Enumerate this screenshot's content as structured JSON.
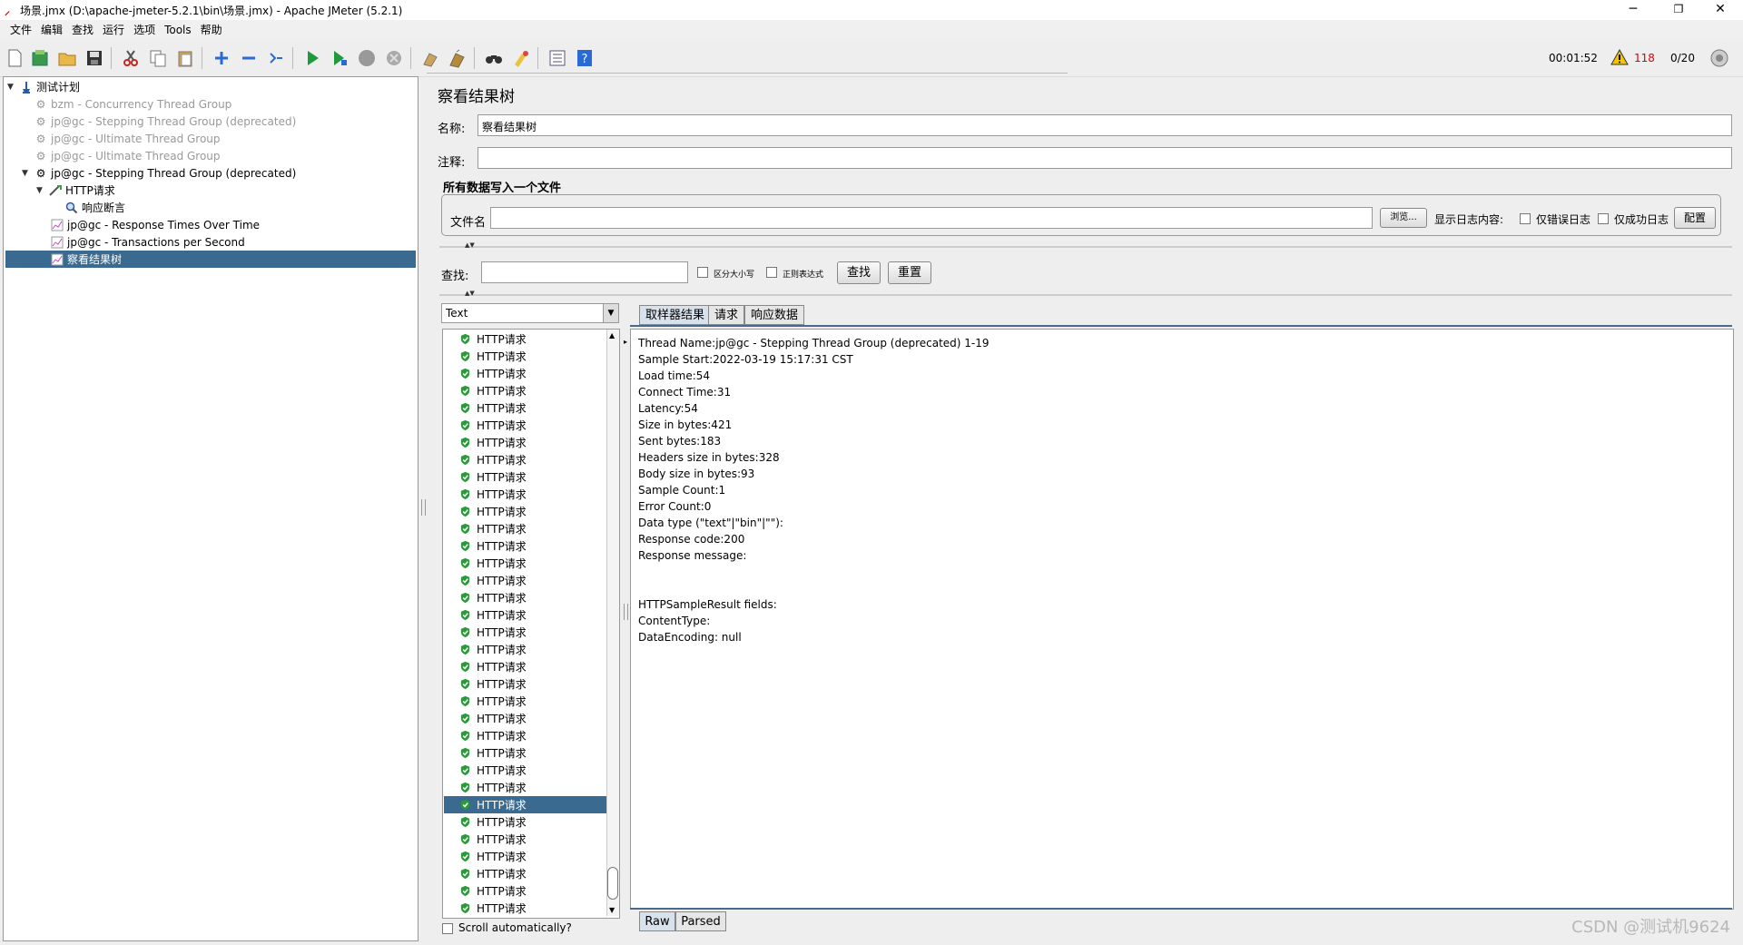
{
  "window": {
    "title": "场景.jmx (D:\\apache-jmeter-5.2.1\\bin\\场景.jmx) - Apache JMeter (5.2.1)",
    "minimize": "─",
    "restore": "❐",
    "close": "✕"
  },
  "menu": [
    "文件",
    "编辑",
    "查找",
    "运行",
    "选项",
    "Tools",
    "帮助"
  ],
  "status": {
    "elapsed": "00:01:52",
    "warnings": "118",
    "threads": "0/20"
  },
  "tree": {
    "items": [
      {
        "label": "测试计划",
        "state": "normal"
      },
      {
        "label": "bzm - Concurrency Thread Group",
        "state": "disabled"
      },
      {
        "label": "jp@gc - Stepping Thread Group (deprecated)",
        "state": "disabled"
      },
      {
        "label": "jp@gc - Ultimate Thread Group",
        "state": "disabled"
      },
      {
        "label": "jp@gc - Ultimate Thread Group",
        "state": "disabled"
      },
      {
        "label": "jp@gc - Stepping Thread Group (deprecated)",
        "state": "normal"
      },
      {
        "label": "HTTP请求",
        "state": "normal"
      },
      {
        "label": "响应断言",
        "state": "normal"
      },
      {
        "label": "jp@gc - Response Times Over Time",
        "state": "normal"
      },
      {
        "label": "jp@gc - Transactions per Second",
        "state": "normal"
      },
      {
        "label": "察看结果树",
        "state": "selected"
      }
    ]
  },
  "panel": {
    "title": "察看结果树",
    "name_label": "名称:",
    "name_value": "察看结果树",
    "comment_label": "注释:",
    "comment_value": "",
    "file_section": "所有数据写入一个文件",
    "filename_label": "文件名",
    "filename_value": "",
    "browse_button": "浏览...",
    "log_label": "显示日志内容:",
    "errors_only": "仅错误日志",
    "success_only": "仅成功日志",
    "config_button": "配置",
    "search_label": "查找:",
    "search_value": "",
    "case_sensitive": "区分大小写",
    "regex": "正则表达式",
    "find_button": "查找",
    "reset_button": "重置",
    "renderer": "Text",
    "scroll_auto": "Scroll automatically?"
  },
  "results": {
    "item_label": "HTTP请求",
    "count": 34,
    "selected_index": 27
  },
  "tabs": [
    "取样器结果",
    "请求",
    "响应数据"
  ],
  "detail_lines": [
    "Thread Name:jp@gc - Stepping Thread Group (deprecated) 1-19",
    "Sample Start:2022-03-19 15:17:31 CST",
    "Load time:54",
    "Connect Time:31",
    "Latency:54",
    "Size in bytes:421",
    "Sent bytes:183",
    "Headers size in bytes:328",
    "Body size in bytes:93",
    "Sample Count:1",
    "Error Count:0",
    "Data type (\"text\"|\"bin\"|\"\"):",
    "Response code:200",
    "Response message:",
    "",
    "",
    "HTTPSampleResult fields:",
    "ContentType:",
    "DataEncoding: null"
  ],
  "bottom_tabs": [
    "Raw",
    "Parsed"
  ],
  "watermark": "CSDN @测试机9624"
}
